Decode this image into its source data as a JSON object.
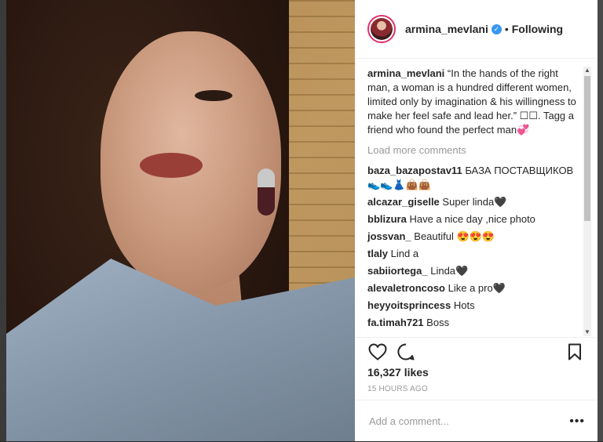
{
  "post": {
    "username": "armina_mevlani",
    "follow_label": "Following",
    "separator": "•",
    "verified_glyph": "✓"
  },
  "caption": {
    "username": "armina_mevlani",
    "text": "“In the hands of the right man, a woman is a hundred different women, limited only by imagination & his willingness to make her feel safe and lead her.” ☐☐. Tagg a friend who found the perfect man💞"
  },
  "load_more": "Load more comments",
  "comments": [
    {
      "user": "baza_bazapostav11",
      "text": "БАЗА ПОСТАВЩИКОВ 👟👟👗👜👜"
    },
    {
      "user": "alcazar_giselle",
      "text": "Super linda🖤"
    },
    {
      "user": "bblizura",
      "text": "Have a nice day ,nice photo"
    },
    {
      "user": "jossvan_",
      "text": "Beautiful 😍😍😍"
    },
    {
      "user": "tlaly",
      "text": "Lind a"
    },
    {
      "user": "sabiiortega_",
      "text": "Linda🖤"
    },
    {
      "user": "alevaletroncoso",
      "text": "Like a pro🖤"
    },
    {
      "user": "heyyoitsprincess",
      "text": "Hots"
    },
    {
      "user": "fa.timah721",
      "text": "Boss"
    }
  ],
  "likes": "16,327 likes",
  "timestamp": "15 HOURS AGO",
  "add_comment": {
    "placeholder": "Add a comment..."
  },
  "more_options": "•••",
  "icons": {
    "like": "heart-icon",
    "comment": "speech-bubble-icon",
    "save": "bookmark-icon",
    "avatar": "avatar",
    "more": "more-options-icon"
  },
  "colors": {
    "verified": "#3897f0",
    "avatar_ring": "#e1306c",
    "text": "#262626",
    "muted": "#999999"
  }
}
